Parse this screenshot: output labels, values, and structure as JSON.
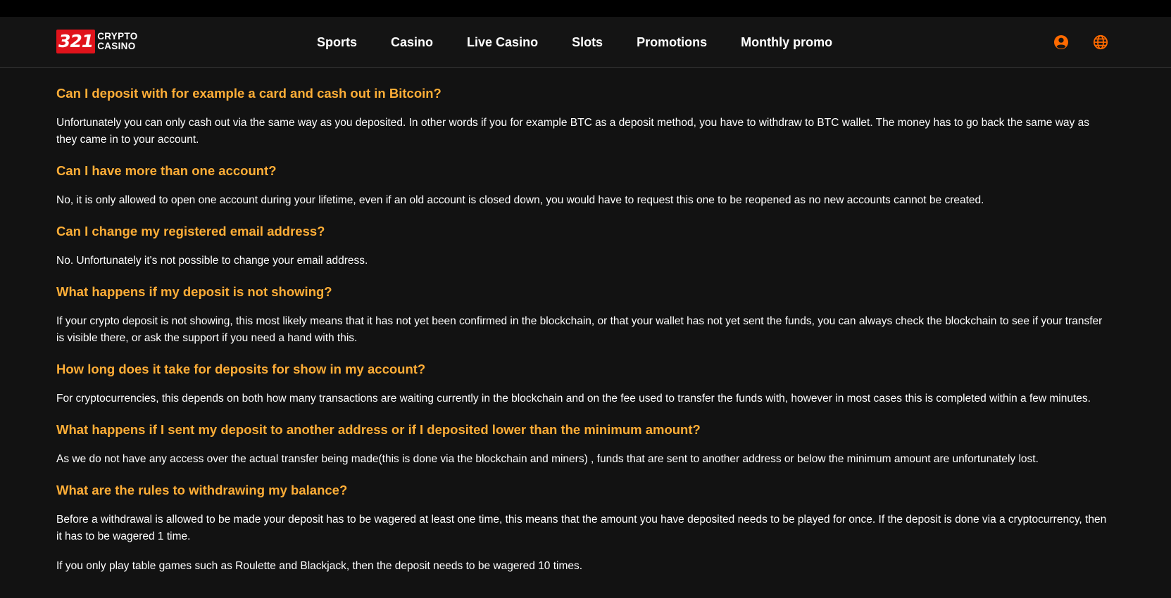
{
  "brand": {
    "logo_number": "321",
    "logo_line1": "CRYPTO",
    "logo_line2": "CASINO"
  },
  "nav": {
    "items": [
      {
        "label": "Sports"
      },
      {
        "label": "Casino"
      },
      {
        "label": "Live Casino"
      },
      {
        "label": "Slots"
      },
      {
        "label": "Promotions"
      },
      {
        "label": "Monthly promo"
      }
    ]
  },
  "header_icons": {
    "user": "user-icon",
    "language": "globe-icon",
    "accent_color": "#ff6a00"
  },
  "colors": {
    "background": "#121212",
    "question": "#ffae37",
    "answer": "#ffffff",
    "logo_red": "#e0131b"
  },
  "faq": [
    {
      "question": "Can I deposit with for example a card and cash out in Bitcoin?",
      "answer": "Unfortunately you can only cash out via the same way as you deposited. In other words if you for example BTC as a deposit method, you have to withdraw to BTC wallet. The money has to go back the same way as they came in to your account."
    },
    {
      "question": "Can I have more than one account?",
      "answer": "No, it is only allowed to open one account during your lifetime, even if an old account is closed down, you would have to request this one to be reopened as no new accounts cannot be created."
    },
    {
      "question": "Can I change my registered email address?",
      "answer": "No. Unfortunately it's not possible to change your email address."
    },
    {
      "question": "What happens if my deposit is not showing?",
      "answer": "If your crypto deposit is not showing, this most likely means that it has not yet been confirmed in the blockchain, or that your wallet has not yet sent the funds, you can always check the blockchain to see if your transfer is visible there, or ask the support if you need a hand with this."
    },
    {
      "question": "How long does it take for deposits for show in my account?",
      "answer": "For cryptocurrencies, this depends on both how many transactions are waiting currently in the blockchain and on the fee used to transfer the funds with, however in most cases this is completed within a few minutes."
    },
    {
      "question": "What happens if I sent my deposit to another address or if I deposited lower than the minimum amount?",
      "answer": "As we do not have any access over the actual transfer being made(this is done via the blockchain and miners) , funds that are sent to another address or below the minimum amount are unfortunately lost."
    },
    {
      "question": "What are the rules to withdrawing my balance?",
      "answer": "Before a withdrawal is allowed to be made your deposit has to be wagered at least one time, this means that the amount you have deposited needs to be played for once. If the deposit is done via a cryptocurrency, then it has to be wagered 1 time.",
      "extra": "If you only play table games such as Roulette and Blackjack, then the deposit needs to be wagered 10 times."
    }
  ]
}
